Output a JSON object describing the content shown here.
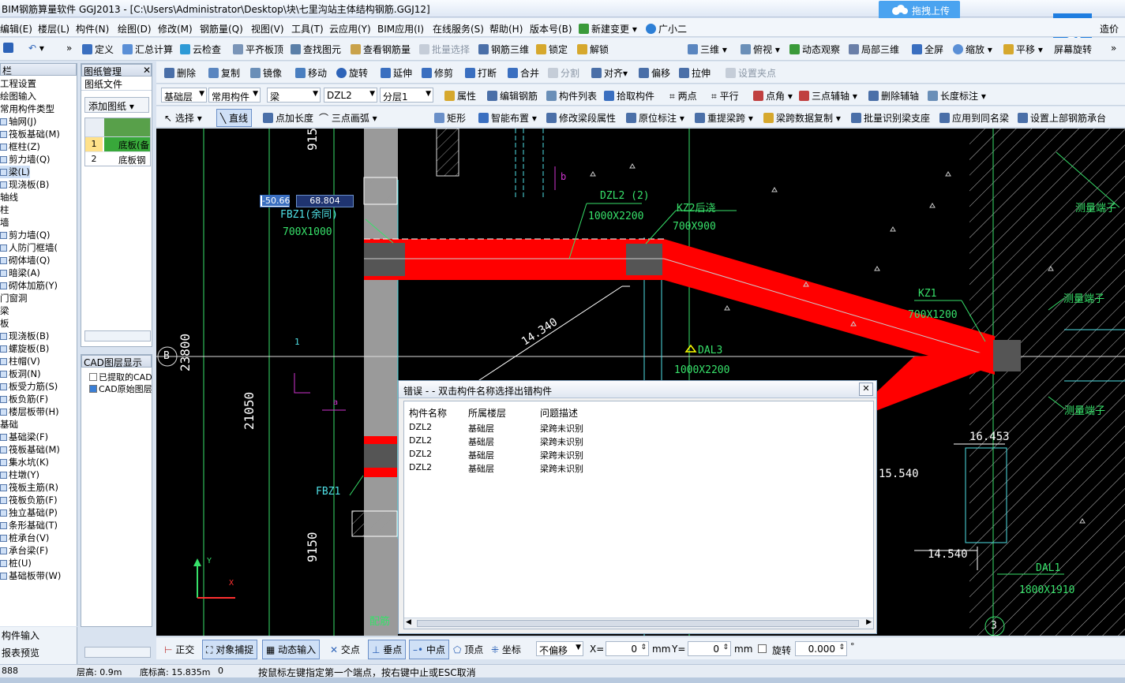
{
  "app": {
    "title": "BIM钢筋算量软件 GGJ2013 - [C:\\Users\\Administrator\\Desktop\\块\\七里沟站主体结构钢筋.GGJ12]",
    "upload_label": "拖拽上传",
    "corner_label": "造价"
  },
  "menu": [
    "编辑(E)",
    "楼层(L)",
    "构件(N)",
    "绘图(D)",
    "修改(M)",
    "钢筋量(Q)",
    "视图(V)",
    "工具(T)",
    "云应用(Y)",
    "BIM应用(I)",
    "在线服务(S)",
    "帮助(H)",
    "版本号(B)",
    "新建变更",
    "广小二"
  ],
  "toolbar1": [
    "定义",
    "汇总计算",
    "云检查",
    "平齐板顶",
    "查找图元",
    "查看钢筋量",
    "批量选择",
    "钢筋三维",
    "锁定",
    "解锁",
    "三维",
    "俯视",
    "动态观察",
    "局部三维",
    "全屏",
    "缩放",
    "平移",
    "屏幕旋转"
  ],
  "toolbar2": [
    "删除",
    "复制",
    "镜像",
    "移动",
    "旋转",
    "延伸",
    "修剪",
    "打断",
    "合并",
    "分割",
    "对齐",
    "偏移",
    "拉伸",
    "设置夹点"
  ],
  "toolbar3": {
    "combos": [
      "基础层",
      "常用构件",
      "梁",
      "DZL2",
      "分层1"
    ],
    "items": [
      "属性",
      "编辑钢筋",
      "构件列表",
      "拾取构件",
      "两点",
      "平行",
      "点角",
      "三点辅轴",
      "删除辅轴",
      "长度标注"
    ]
  },
  "toolbar4": [
    "选择",
    "直线",
    "点加长度",
    "三点画弧",
    "矩形",
    "智能布置",
    "修改梁段属性",
    "原位标注",
    "重提梁跨",
    "梁跨数据复制",
    "批量识别梁支座",
    "应用到同名梁",
    "设置上部钢筋承台"
  ],
  "left_panel": {
    "header": "栏",
    "items": [
      "工程设置",
      "绘图输入",
      "常用构件类型",
      "轴网(J)",
      "筏板基础(M)",
      "框柱(Z)",
      "剪力墙(Q)",
      "梁(L)",
      "现浇板(B)",
      "轴线",
      "柱",
      "墙",
      "剪力墙(Q)",
      "人防门框墙(",
      "砌体墙(Q)",
      "暗梁(A)",
      "砌体加筋(Y)",
      "门窗洞",
      "梁",
      "板",
      "现浇板(B)",
      "螺旋板(B)",
      "柱帽(V)",
      "板洞(N)",
      "板受力筋(S)",
      "板负筋(F)",
      "楼层板带(H)",
      "基础",
      "基础梁(F)",
      "筏板基础(M)",
      "集水坑(K)",
      "柱墩(Y)",
      "筏板主筋(R)",
      "筏板负筋(F)",
      "独立基础(P)",
      "条形基础(T)",
      "桩承台(V)",
      "承台梁(F)",
      "桩(U)",
      "基础板带(W)"
    ],
    "bottom_items": [
      "构件输入",
      "报表预览"
    ]
  },
  "drawing_panel": {
    "header": "图纸管理",
    "tab": "图纸文件",
    "add_button": "添加图纸",
    "rows": [
      {
        "n": "1",
        "name": "底板(备"
      },
      {
        "n": "2",
        "name": "底板钢"
      }
    ]
  },
  "cad_panel": {
    "header": "CAD图层显示",
    "items": [
      "已提取的CAD",
      "CAD原始图层"
    ]
  },
  "canvas": {
    "input_x": "-50.66",
    "input_y": "68.804",
    "labels": {
      "dim9150_top": "9150",
      "dim23800": "23800",
      "dim21050": "21050",
      "dim9150_bottom": "9150",
      "fbz1_top": "FBZ1(余同)",
      "fbz1_size": "700X1000",
      "dzl2": "DZL2 (2)",
      "dzl2_size": "1000X2200",
      "kz2": "KZ2后浇",
      "kz2_size": "700X900",
      "kz1": "KZ1",
      "kz1_size": "700X1200",
      "dal3": "DAL3",
      "dal3_size": "1000X2200",
      "dim14340": "14.340",
      "measure1": "测量端子",
      "measure2": "测量端子",
      "measure3": "测量端子",
      "fbz1_bottom": "FBZ1",
      "axis_b": "B",
      "axis_3": "3",
      "mark1": "1",
      "mark_a": "a",
      "mark_b": "b",
      "dim16453": "16.453",
      "dim15540": "15.540",
      "dim14540": "14.540",
      "dal1": "DAL1",
      "dal1_size": "1800X1910",
      "pei": "配筋",
      "axis_y": "Y",
      "axis_x": "X"
    }
  },
  "error_dialog": {
    "title": "错误 - - 双击构件名称选择出错构件",
    "columns": [
      "构件名称",
      "所属楼层",
      "问题描述"
    ],
    "rows": [
      [
        "DZL2",
        "基础层",
        "梁跨未识别"
      ],
      [
        "DZL2",
        "基础层",
        "梁跨未识别"
      ],
      [
        "DZL2",
        "基础层",
        "梁跨未识别"
      ],
      [
        "DZL2",
        "基础层",
        "梁跨未识别"
      ]
    ]
  },
  "snap_bar": {
    "items": [
      "正交",
      "对象捕捉",
      "动态输入",
      "交点",
      "垂点",
      "中点",
      "顶点",
      "坐标"
    ],
    "offset_mode": "不偏移",
    "x_label": "X=",
    "x_value": "0",
    "y_label": "Y=",
    "y_value": "0",
    "unit": "mm",
    "rotate_label": "旋转",
    "rotate_value": "0.000"
  },
  "status": {
    "coord": "888",
    "floor_height": "层高: 0.9m",
    "base_height": "底标高: 15.835m",
    "zero": "0",
    "hint": "按鼠标左键指定第一个端点，按右键中止或ESC取消"
  },
  "colors": {
    "canvas_bg": "#000000",
    "beam_red": "#ff0000",
    "cad_green": "#37e06a",
    "cad_cyan": "#4fe0e6",
    "accent_blue": "#1e7de0"
  }
}
